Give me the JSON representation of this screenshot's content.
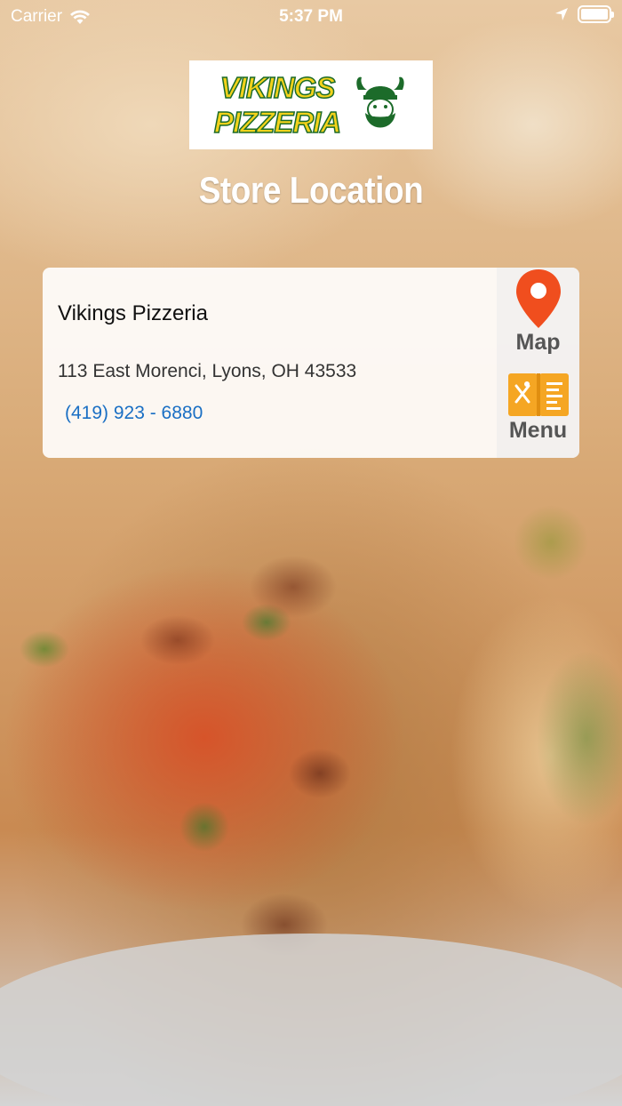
{
  "status_bar": {
    "carrier": "Carrier",
    "time": "5:37 PM",
    "battery_level": 1.0
  },
  "logo": {
    "line1": "VIKINGS",
    "line2": "PIZZERIA",
    "colors": {
      "text": "#f2d21b",
      "outline": "#1c6b2a"
    }
  },
  "page": {
    "title": "Store Location"
  },
  "store": {
    "name": "Vikings Pizzeria",
    "address": "113 East Morenci, Lyons, OH 43533",
    "phone": "(419) 923 - 6880"
  },
  "actions": {
    "map_label": "Map",
    "menu_label": "Menu"
  },
  "colors": {
    "map_pin": "#f04e1e",
    "menu_icon": "#f5a623",
    "phone_link": "#1a6fc4"
  }
}
